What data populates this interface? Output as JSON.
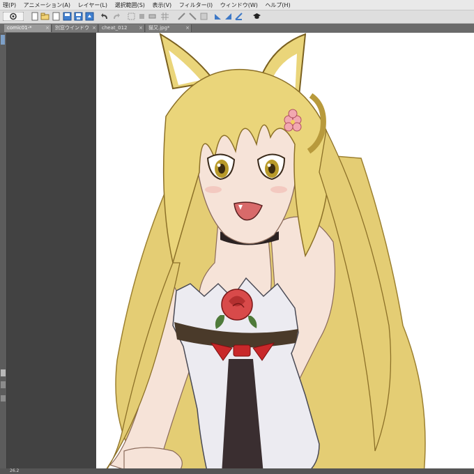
{
  "menu": {
    "items": [
      "理(P)",
      "アニメーション(A)",
      "レイヤー(L)",
      "選択範囲(S)",
      "表示(V)",
      "フィルター(I)",
      "ウィンドウ(W)",
      "ヘルプ(H)"
    ]
  },
  "toolbar": {
    "icons": [
      "app-logo-icon",
      "new-file-icon",
      "open-folder-icon",
      "blank-page-icon",
      "save-icon",
      "save-as-icon",
      "export-icon",
      "undo-icon",
      "redo-icon",
      "transform-icon",
      "rotate-icon",
      "flip-icon",
      "grid-icon",
      "ruler-icon",
      "snap-icon",
      "mirror-icon",
      "settings-icon"
    ]
  },
  "tabs": [
    {
      "label": "comic01-*",
      "active": true
    },
    {
      "label": "別窓ウインドウ",
      "active": false
    },
    {
      "label": "cheat_012",
      "active": false
    },
    {
      "label": "猫又.jpg*",
      "active": false
    }
  ],
  "status": {
    "zoom": "26.2"
  },
  "colors": {
    "hair": "#e8d27a",
    "hair_shadow": "#b89a3c",
    "skin": "#f6e3d8",
    "rose": "#d84a4a",
    "ribbon": "#c8282a",
    "dress": "#ecebf1"
  }
}
